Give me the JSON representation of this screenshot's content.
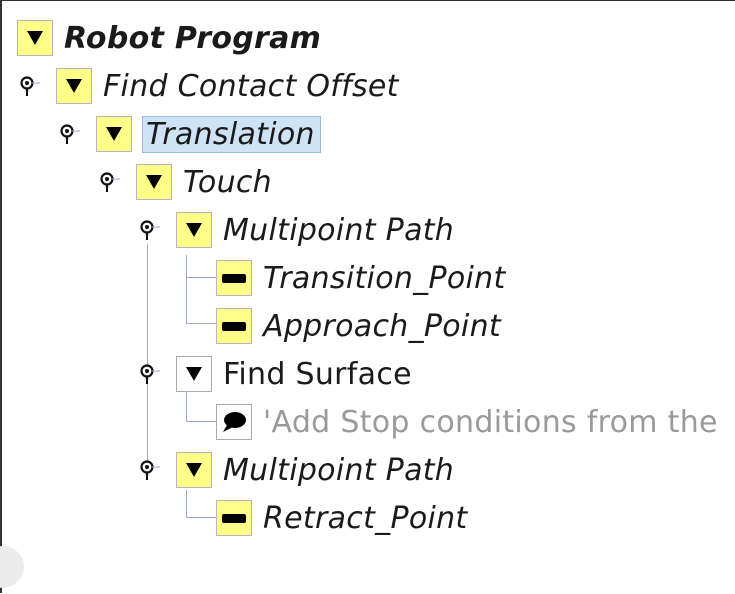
{
  "tree": {
    "root_label": "Robot Program",
    "find_contact_offset": "Find Contact Offset",
    "translation": "Translation",
    "touch": "Touch",
    "multipoint_path_1": "Multipoint Path",
    "transition_point": "Transition_Point",
    "approach_point": "Approach_Point",
    "find_surface": "Find Surface",
    "comment": "'Add Stop conditions from the",
    "multipoint_path_2": "Multipoint Path",
    "retract_point": "Retract_Point"
  },
  "icons": {
    "expand": "triangle-down-icon",
    "waypoint": "waypoint-dash-icon",
    "comment": "speech-bubble-icon",
    "connector": "pin-icon"
  },
  "colors": {
    "node_yellow": "#ffff88",
    "selection": "#cfe3f7",
    "tree_line": "#9aa7d9"
  }
}
